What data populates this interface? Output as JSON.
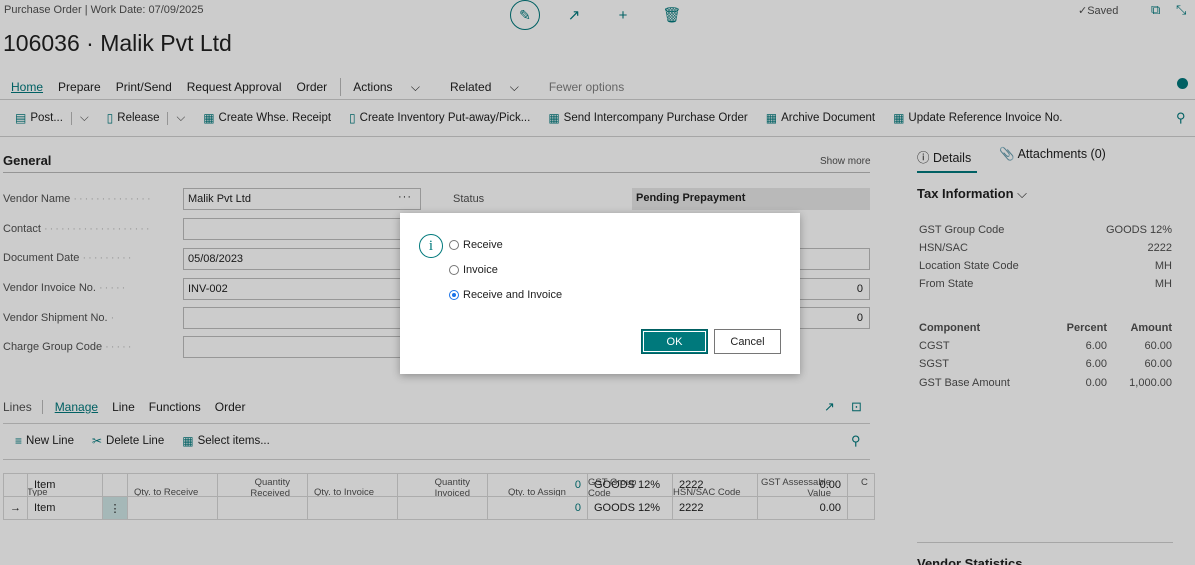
{
  "header": {
    "breadcrumb": "Purchase Order | Work Date: 07/09/2025",
    "saved": "Saved",
    "title": "106036 · Malik Pvt Ltd"
  },
  "menu": {
    "home": "Home",
    "prepare": "Prepare",
    "print_send": "Print/Send",
    "request_approval": "Request Approval",
    "order": "Order",
    "actions": "Actions",
    "related": "Related",
    "fewer": "Fewer options"
  },
  "toolbar": {
    "post": "Post...",
    "release": "Release",
    "whse_receipt": "Create Whse. Receipt",
    "putaway": "Create Inventory Put-away/Pick...",
    "interco": "Send Intercompany Purchase Order",
    "archive": "Archive Document",
    "update_ref": "Update Reference Invoice No."
  },
  "general": {
    "title": "General",
    "show_more": "Show more",
    "vendor_name_label": "Vendor Name",
    "vendor_name": "Malik Pvt Ltd",
    "contact_label": "Contact",
    "document_date_label": "Document Date",
    "document_date": "05/08/2023",
    "vendor_invoice_label": "Vendor Invoice No.",
    "vendor_invoice": "INV-002",
    "vendor_shipment_label": "Vendor Shipment No.",
    "charge_group_label": "Charge Group Code",
    "status_label": "Status",
    "status": "Pending Prepayment",
    "right_val_1": "0",
    "right_val_2": "0"
  },
  "side": {
    "details_tab": "Details",
    "attachments_tab": "Attachments (0)",
    "tax_title": "Tax Information",
    "rows": [
      {
        "label": "GST Group Code",
        "value": "GOODS 12%"
      },
      {
        "label": "HSN/SAC",
        "value": "2222"
      },
      {
        "label": "Location State Code",
        "value": "MH"
      },
      {
        "label": "From State",
        "value": "MH"
      }
    ],
    "comp_header": {
      "component": "Component",
      "percent": "Percent",
      "amount": "Amount"
    },
    "components": [
      {
        "name": "CGST",
        "percent": "6.00",
        "amount": "60.00"
      },
      {
        "name": "SGST",
        "percent": "6.00",
        "amount": "60.00"
      },
      {
        "name": "GST Base Amount",
        "percent": "0.00",
        "amount": "1,000.00"
      }
    ],
    "vendor_stats": "Vendor Statistics"
  },
  "lines": {
    "title": "Lines",
    "manage": "Manage",
    "line": "Line",
    "functions": "Functions",
    "order": "Order",
    "new_line": "New Line",
    "delete_line": "Delete Line",
    "select_items": "Select items...",
    "cols": {
      "type": "Type",
      "qty_to_receive": "Qty. to Receive",
      "qty_received": "Quantity Received",
      "qty_to_invoice": "Qty. to Invoice",
      "qty_invoiced": "Quantity Invoiced",
      "qty_to_assign": "Qty. to Assign",
      "gst_group": "GST Group Code",
      "hsn": "HSN/SAC Code",
      "gst_assessable": "GST Assessable Value",
      "c": "C"
    },
    "rows": [
      {
        "type": "Item",
        "assign": "0",
        "gst": "GOODS 12%",
        "hsn": "2222",
        "assessable": "0.00"
      },
      {
        "type": "Item",
        "assign": "0",
        "gst": "GOODS 12%",
        "hsn": "2222",
        "assessable": "0.00"
      }
    ]
  },
  "dialog": {
    "options": [
      "Receive",
      "Invoice",
      "Receive and Invoice"
    ],
    "selected": "Receive and Invoice",
    "ok": "OK",
    "cancel": "Cancel"
  },
  "colors": {
    "accent": "#00797c"
  }
}
